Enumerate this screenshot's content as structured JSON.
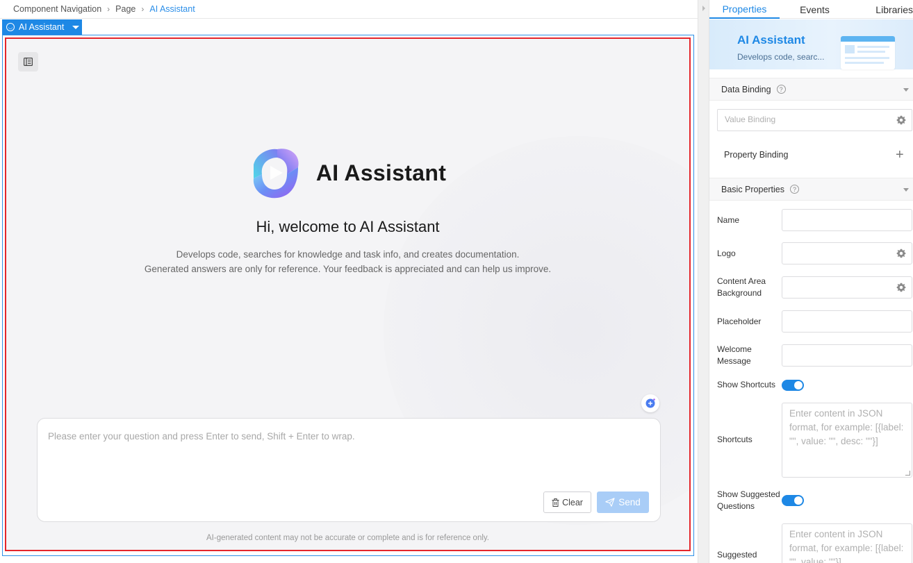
{
  "breadcrumb": {
    "items": [
      "Component Navigation",
      "Page",
      "AI Assistant"
    ]
  },
  "component_tag": {
    "label": "AI Assistant"
  },
  "canvas": {
    "app_title": "AI Assistant",
    "welcome": "Hi, welcome to AI Assistant",
    "description_line1": "Develops code, searches for knowledge and task info, and creates documentation.",
    "description_line2": "Generated answers are only for reference. Your feedback is appreciated and can help us improve.",
    "input_placeholder": "Please enter your question and press Enter to send, Shift + Enter to wrap.",
    "clear_label": "Clear",
    "send_label": "Send",
    "disclaimer": "AI-generated content may not be accurate or complete and is for reference only."
  },
  "panel": {
    "tabs": [
      "Properties",
      "Events",
      "Libraries"
    ],
    "banner": {
      "title": "AI Assistant",
      "subtitle": "Develops code, searc..."
    },
    "data_binding": {
      "title": "Data Binding",
      "value_binding_placeholder": "Value Binding",
      "property_binding_label": "Property Binding"
    },
    "basic_properties": {
      "title": "Basic Properties",
      "name_label": "Name",
      "logo_label": "Logo",
      "content_bg_label_1": "Content Area",
      "content_bg_label_2": "Background",
      "placeholder_label": "Placeholder",
      "welcome_label_1": "Welcome",
      "welcome_label_2": "Message",
      "show_shortcuts_label": "Show Shortcuts",
      "show_shortcuts_on": true,
      "shortcuts_label": "Shortcuts",
      "shortcuts_placeholder": "Enter content in JSON format, for example: [{label: \"\", value: \"\", desc: \"\"}]",
      "show_suggested_label_1": "Show Suggested",
      "show_suggested_label_2": "Questions",
      "show_suggested_on": true,
      "suggested_label": "Suggested",
      "suggested_placeholder": "Enter content in JSON format, for example: [{label: \"\", value: \"\"}]"
    }
  },
  "colors": {
    "accent": "#1e88e5",
    "selection_red": "#e4252b",
    "send_disabled": "#a9cdf7"
  }
}
